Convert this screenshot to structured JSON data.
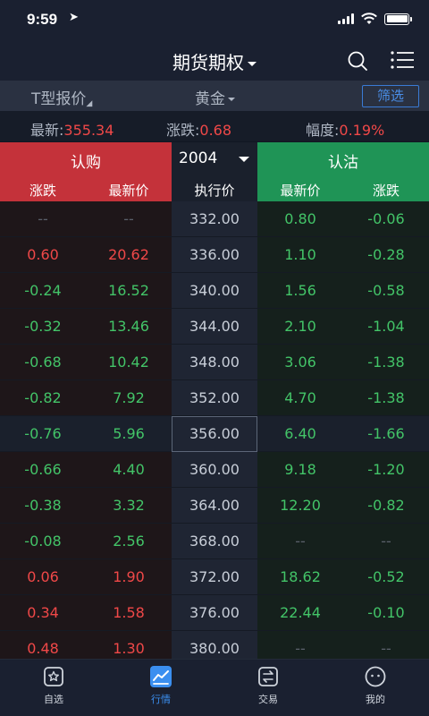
{
  "status": {
    "time": "9:59"
  },
  "nav": {
    "title": "期货期权"
  },
  "filter": {
    "mode": "T型报价",
    "underlying": "黄金",
    "button": "筛选"
  },
  "quote": {
    "latest_label": "最新:",
    "latest_value": "355.34",
    "change_label": "涨跌:",
    "change_value": "0.68",
    "pct_label": "幅度:",
    "pct_value": "0.19%"
  },
  "header": {
    "call_title": "认购",
    "put_title": "认沽",
    "month": "2004",
    "call_change": "涨跌",
    "call_last": "最新价",
    "strike": "执行价",
    "put_last": "最新价",
    "put_change": "涨跌"
  },
  "colors": {
    "call_header": "#c4323a",
    "put_header": "#1f9456",
    "up": "#f04848",
    "down": "#43c468",
    "accent": "#3b8ff0"
  },
  "rows": [
    {
      "call_change": "--",
      "call_last": "--",
      "strike": "332.00",
      "put_last": "0.80",
      "put_change": "-0.06"
    },
    {
      "call_change": "0.60",
      "call_last": "20.62",
      "strike": "336.00",
      "put_last": "1.10",
      "put_change": "-0.28"
    },
    {
      "call_change": "-0.24",
      "call_last": "16.52",
      "strike": "340.00",
      "put_last": "1.56",
      "put_change": "-0.58"
    },
    {
      "call_change": "-0.32",
      "call_last": "13.46",
      "strike": "344.00",
      "put_last": "2.10",
      "put_change": "-1.04"
    },
    {
      "call_change": "-0.68",
      "call_last": "10.42",
      "strike": "348.00",
      "put_last": "3.06",
      "put_change": "-1.38"
    },
    {
      "call_change": "-0.82",
      "call_last": "7.92",
      "strike": "352.00",
      "put_last": "4.70",
      "put_change": "-1.38"
    },
    {
      "call_change": "-0.76",
      "call_last": "5.96",
      "strike": "356.00",
      "put_last": "6.40",
      "put_change": "-1.66"
    },
    {
      "call_change": "-0.66",
      "call_last": "4.40",
      "strike": "360.00",
      "put_last": "9.18",
      "put_change": "-1.20"
    },
    {
      "call_change": "-0.38",
      "call_last": "3.32",
      "strike": "364.00",
      "put_last": "12.20",
      "put_change": "-0.82"
    },
    {
      "call_change": "-0.08",
      "call_last": "2.56",
      "strike": "368.00",
      "put_last": "--",
      "put_change": "--"
    },
    {
      "call_change": "0.06",
      "call_last": "1.90",
      "strike": "372.00",
      "put_last": "18.62",
      "put_change": "-0.52"
    },
    {
      "call_change": "0.34",
      "call_last": "1.58",
      "strike": "376.00",
      "put_last": "22.44",
      "put_change": "-0.10"
    },
    {
      "call_change": "0.48",
      "call_last": "1.30",
      "strike": "380.00",
      "put_last": "--",
      "put_change": "--"
    }
  ],
  "tabs": [
    {
      "label": "自选",
      "icon": "star-icon",
      "active": false
    },
    {
      "label": "行情",
      "icon": "chart-icon",
      "active": true
    },
    {
      "label": "交易",
      "icon": "exchange-icon",
      "active": false
    },
    {
      "label": "我的",
      "icon": "profile-icon",
      "active": false
    }
  ]
}
